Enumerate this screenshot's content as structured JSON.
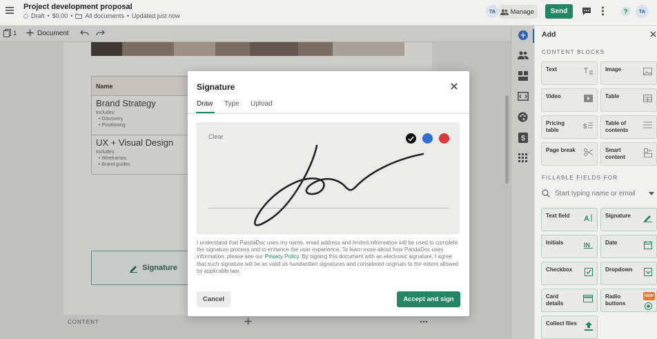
{
  "header": {
    "title": "Project development proposal",
    "status": "Draft",
    "price": "$0.00",
    "folder": "All documents",
    "updated": "Updated just now",
    "avatar_initials": "TA",
    "manage_label": "Manage",
    "send_label": "Send"
  },
  "toolbar": {
    "page_count": "1",
    "document_label": "Document"
  },
  "document": {
    "table_header": "Name",
    "rows": [
      {
        "title": "Brand Strategy",
        "includes": "Includes:",
        "items": [
          "Discovery",
          "Positioning"
        ]
      },
      {
        "title": "UX + Visual Design",
        "includes": "Includes:",
        "items": [
          "Wireframes",
          "Brand guides"
        ]
      }
    ],
    "signature_block": "Signature",
    "content_label": "CONTENT"
  },
  "modal": {
    "title": "Signature",
    "tabs": [
      "Draw",
      "Type",
      "Upload"
    ],
    "active_tab": "Draw",
    "clear_label": "Clear",
    "ink_colors": [
      "#111111",
      "#2f6fd0",
      "#d63b3b"
    ],
    "legal_text_before": "I understand that PandaDoc uses my name, email address and limited information will be used to complete the signature process and to enhance the user experience. To learn more about how PandaDoc uses information, please see our ",
    "legal_link": "Privacy Policy",
    "legal_text_after": ". By signing this document with an electronic signature, I agree that such signature will be as valid as handwritten signatures and considered originals to the extent allowed by applicable law.",
    "cancel_label": "Cancel",
    "accept_label": "Accept and sign"
  },
  "panel": {
    "title": "Add",
    "content_blocks_label": "CONTENT BLOCKS",
    "content_blocks": [
      "Text",
      "Image",
      "Video",
      "Table",
      "Pricing table",
      "Table of contents",
      "Page break",
      "Smart content"
    ],
    "fillable_label": "FILLABLE FIELDS FOR",
    "search_placeholder": "Start typing name or email",
    "fields": [
      "Text field",
      "Signature",
      "Initials",
      "Date",
      "Checkbox",
      "Dropdown",
      "Card details",
      "Radio buttons",
      "Collect files"
    ],
    "new_badge": "NEW"
  },
  "colors": {
    "accent": "#248567",
    "overlay": "rgba(60,60,60,0.22)"
  }
}
